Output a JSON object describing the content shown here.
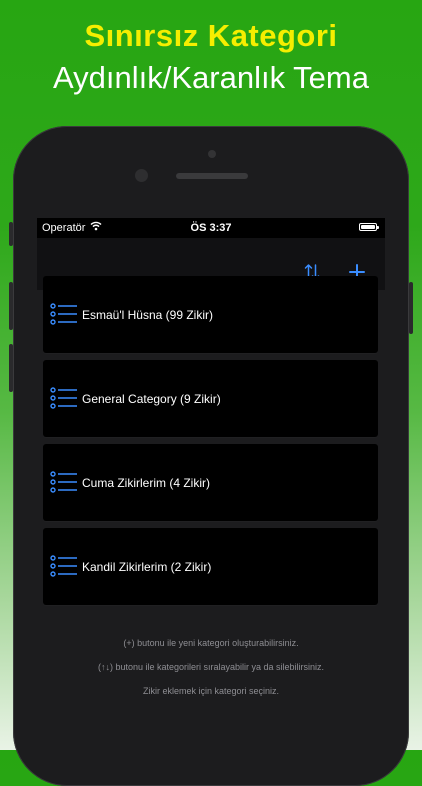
{
  "promo": {
    "headline": "Sınırsız Kategori",
    "subheadline": "Aydınlık/Karanlık Tema"
  },
  "status_bar": {
    "carrier": "Operatör",
    "time": "ÖS 3:37"
  },
  "toolbar": {
    "sort_icon": "sort-arrows-icon",
    "add_icon": "plus-icon"
  },
  "categories": [
    {
      "label": "Esmaü'l Hüsna (99 Zikir)"
    },
    {
      "label": "General Category (9 Zikir)"
    },
    {
      "label": "Cuma Zikirlerim (4 Zikir)"
    },
    {
      "label": "Kandil Zikirlerim (2 Zikir)"
    }
  ],
  "hints": [
    "(+) butonu ile yeni kategori oluşturabilirsiniz.",
    "(↑↓) butonu ile kategorileri sıralayabilir ya da silebilirsiniz.",
    "Zikir eklemek için kategori seçiniz."
  ],
  "colors": {
    "headline": "#f5ee00",
    "accent": "#3a8dff",
    "row_background": "#000000"
  }
}
